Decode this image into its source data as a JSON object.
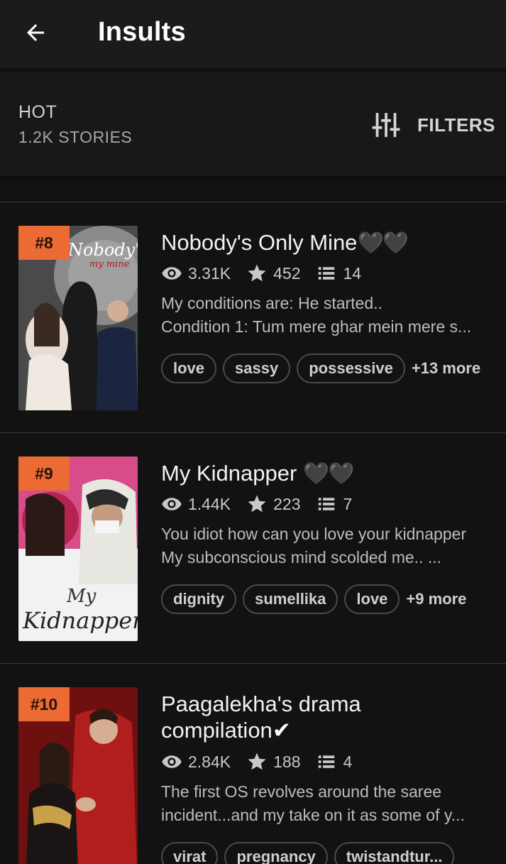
{
  "header": {
    "title": "Insults"
  },
  "sortbar": {
    "label": "HOT",
    "count": "1.2K STORIES",
    "filters_label": "FILTERS"
  },
  "stories": [
    {
      "rank": "#8",
      "title": "Nobody's Only Mine",
      "title_suffix": "🖤🖤",
      "reads": "3.31K",
      "votes": "452",
      "parts": "14",
      "desc_line1": "My conditions are: He started..",
      "desc_line2": "Condition 1: Tum mere ghar mein mere s...",
      "tags": [
        "love",
        "sassy",
        "possessive"
      ],
      "more": "+13 more",
      "cover_text": "Nobody's",
      "cover_sub": "my mine",
      "colors": {
        "cover_bg": "#6b6b6b"
      }
    },
    {
      "rank": "#9",
      "title": "My Kidnapper",
      "title_suffix": "🖤🖤",
      "reads": "1.44K",
      "votes": "223",
      "parts": "7",
      "desc_line1": "You idiot how can you love your kidnapper",
      "desc_line2": "My subconscious mind scolded me.. ...",
      "tags": [
        "dignity",
        "sumellika",
        "love"
      ],
      "more": "+9 more",
      "cover_text": "Kidnapper",
      "cover_sub": "My",
      "colors": {
        "cover_bg": "#c2387a"
      }
    },
    {
      "rank": "#10",
      "title_line1": "Paagalekha's drama",
      "title_line2": "compilation",
      "title_suffix": "✔",
      "reads": "2.84K",
      "votes": "188",
      "parts": "4",
      "desc_line1": "The first OS revolves around the saree",
      "desc_line2": "incident...and my take on it as some of y...",
      "tags": [
        "virat",
        "pregnancy",
        "twistandtur..."
      ],
      "colors": {
        "cover_bg": "#9c1a1a"
      }
    }
  ],
  "icons": {
    "back": "arrow-left-icon",
    "filters": "sliders-icon",
    "reads": "eye-icon",
    "votes": "star-icon",
    "parts": "list-icon"
  },
  "colors": {
    "background": "#121212",
    "topbar": "#1b1b1b",
    "rank_badge": "#ec6a34",
    "text_primary": "#f2f2f2",
    "text_secondary": "#bcbcbc"
  }
}
